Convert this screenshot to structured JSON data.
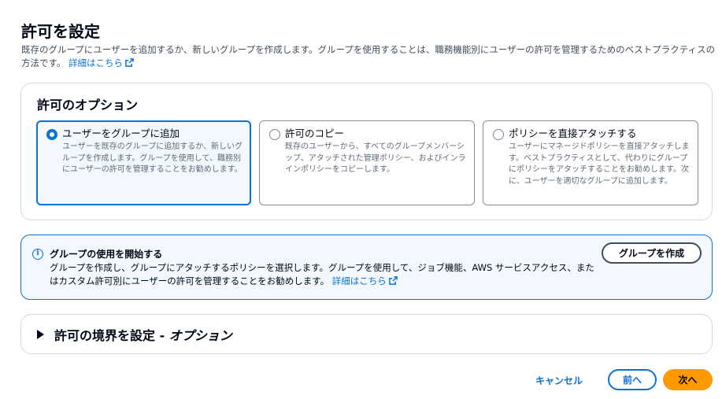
{
  "page": {
    "title": "許可を設定",
    "description": "既存のグループにユーザーを追加するか、新しいグループを作成します。グループを使用することは、職務機能別にユーザーの許可を管理するためのベストプラクティスの方法です。",
    "details_link": "詳細はこちら"
  },
  "options": {
    "heading": "許可のオプション",
    "tiles": [
      {
        "title": "ユーザーをグループに追加",
        "description": "ユーザーを既存のグループに追加するか、新しいグループを作成します。グループを使用して、職務別にユーザーの許可を管理することをお勧めします。",
        "selected": true
      },
      {
        "title": "許可のコピー",
        "description": "既存のユーザーから、すべてのグループメンバーシップ、アタッチされた管理ポリシー、およびインラインポリシーをコピーします。",
        "selected": false
      },
      {
        "title": "ポリシーを直接アタッチする",
        "description": "ユーザーにマネージドポリシーを直接アタッチします。ベストプラクティスとして、代わりにグループにポリシーをアタッチすることをお勧めします。次に、ユーザーを適切なグループに追加します。",
        "selected": false
      }
    ]
  },
  "info": {
    "title": "グループの使用を開始する",
    "text": "グループを作成し、グループにアタッチするポリシーを選択します。グループを使用して、ジョブ機能、AWS サービスアクセス、またはカスタム許可別にユーザーの許可を管理することをお勧めします。",
    "details_link": "詳細はこちら",
    "create_button": "グループを作成"
  },
  "boundary": {
    "label": "許可の境界を設定 - ",
    "label_optional": "オプション"
  },
  "footer": {
    "cancel": "キャンセル",
    "previous": "前へ",
    "next": "次へ"
  },
  "colors": {
    "accent": "#0972d3",
    "primary_button": "#ff9900",
    "info_background": "#f2f8fd"
  }
}
